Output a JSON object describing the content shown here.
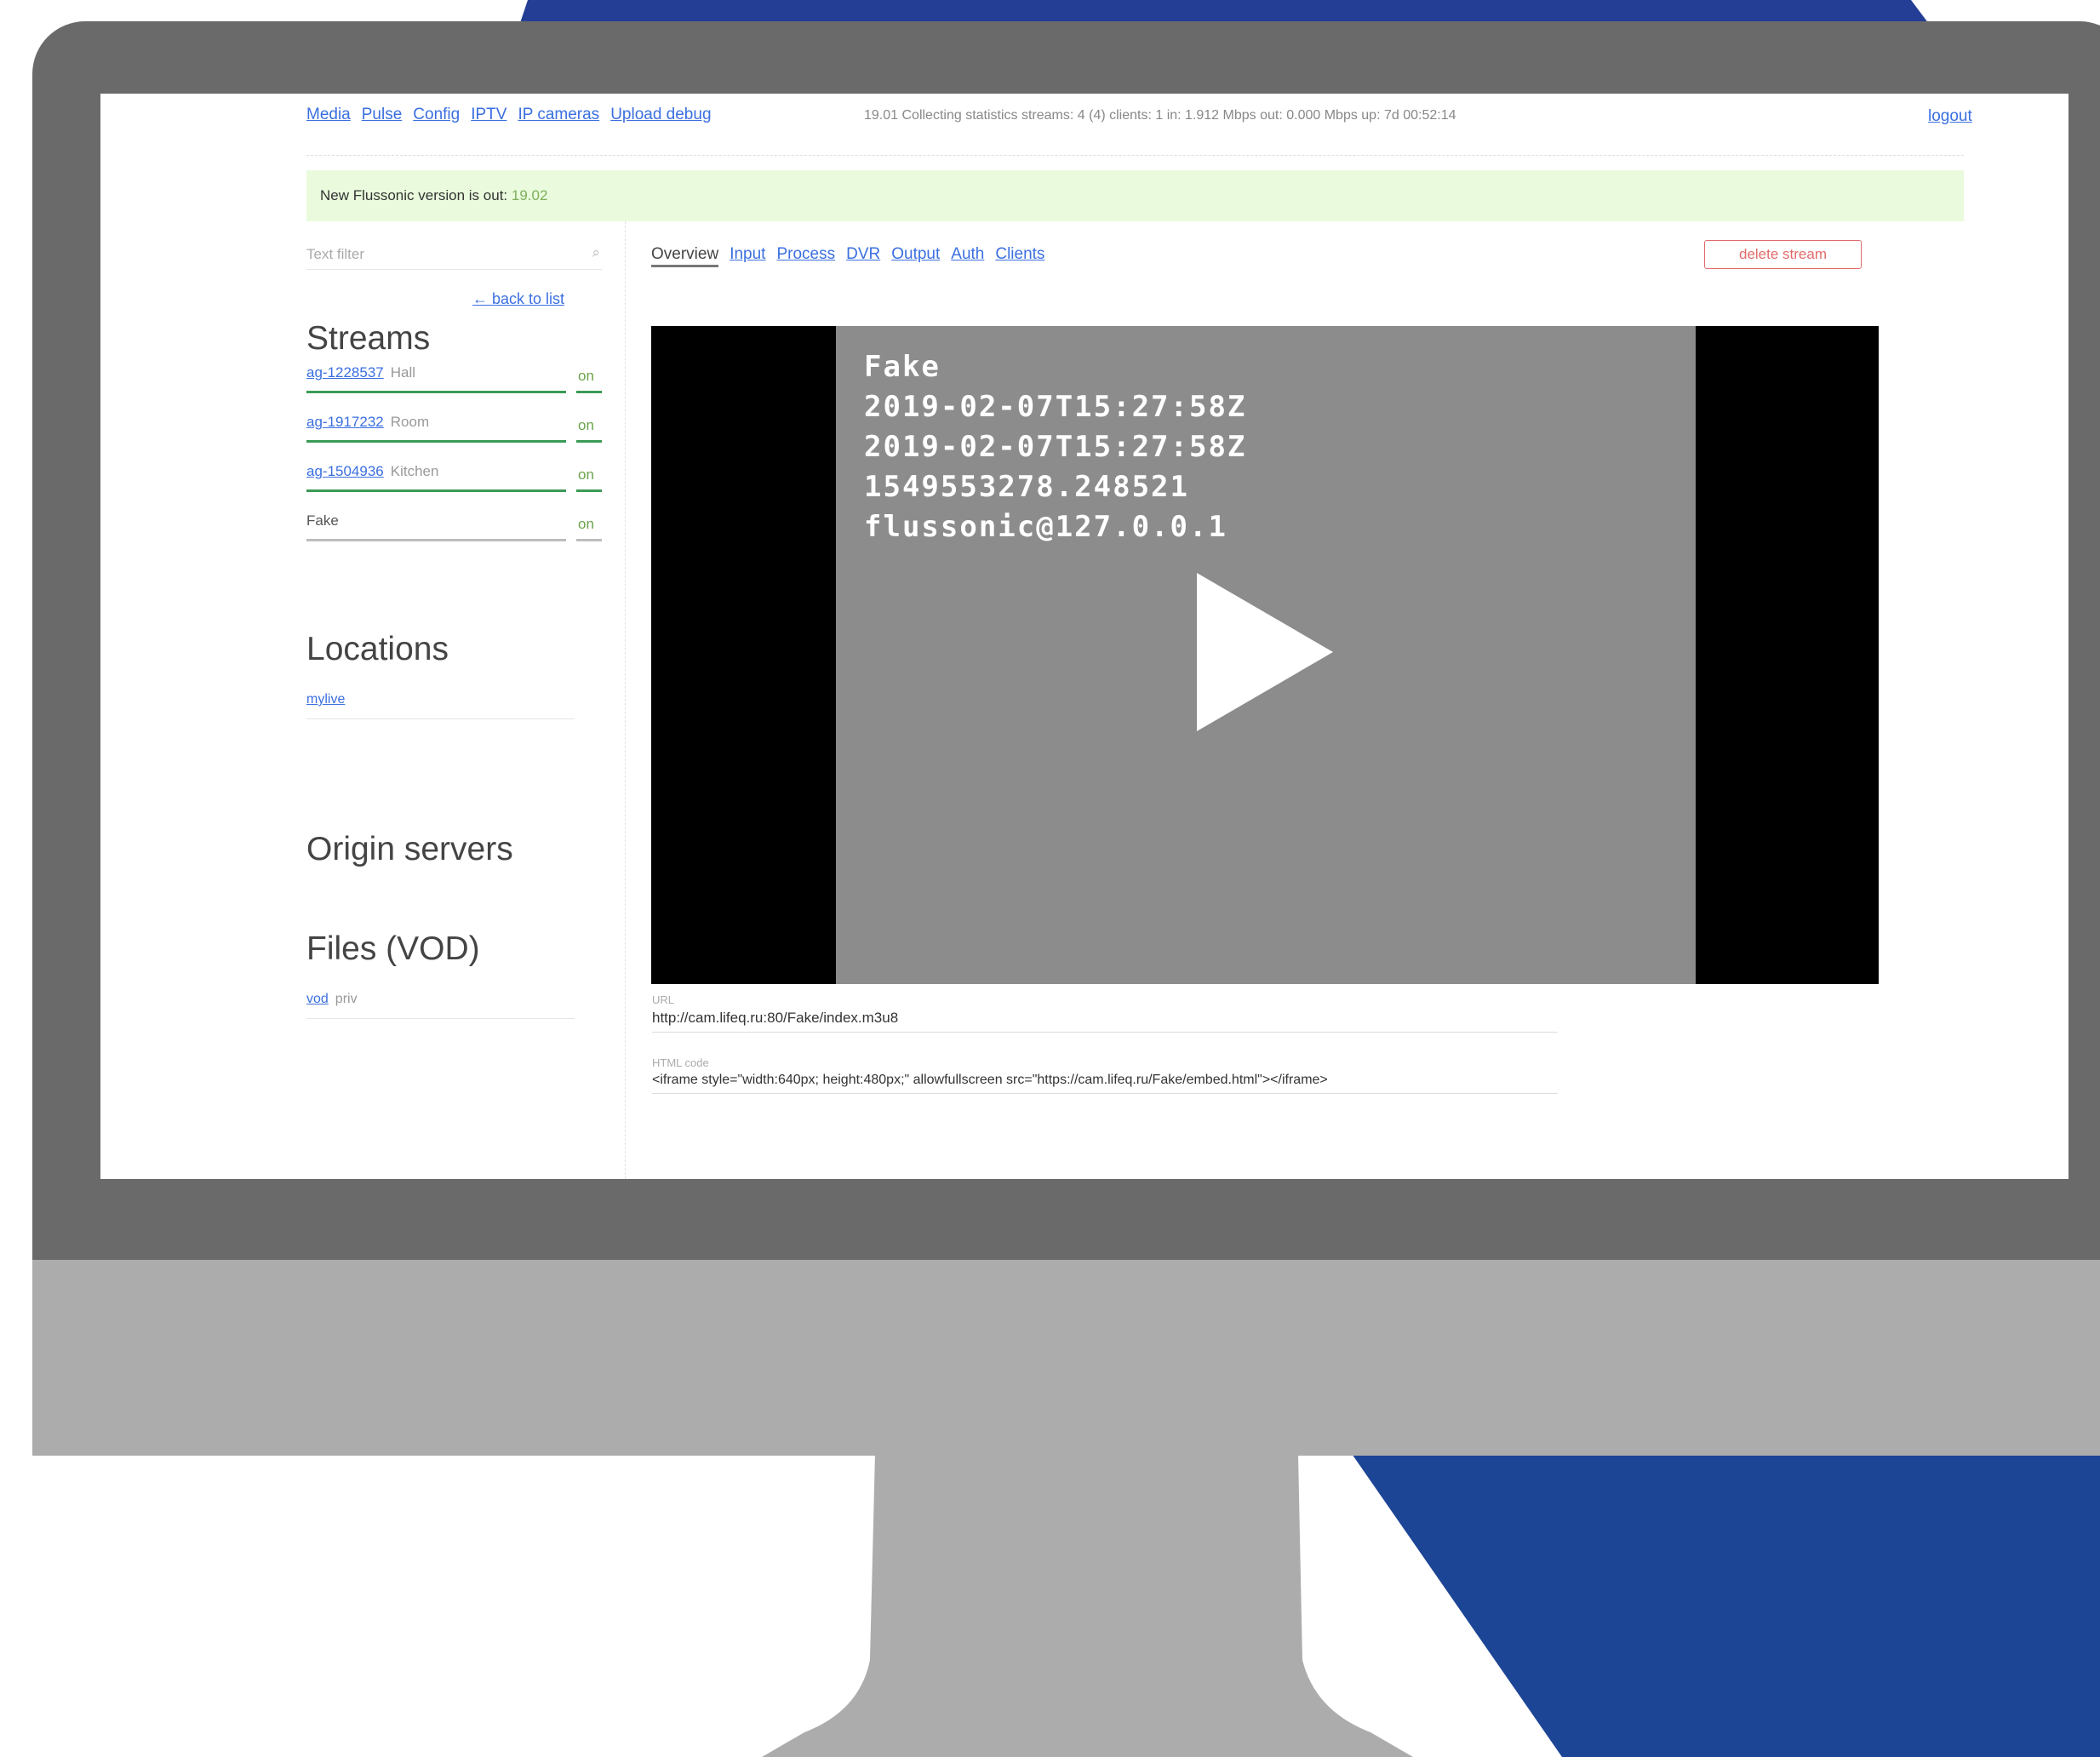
{
  "colors": {
    "accent_blue": "#1d4596",
    "bezel": "#6a6a6a",
    "chin": "#acacac",
    "link": "#3b6fe0",
    "banner_bg": "#e9fbdc",
    "status_on": "#3b9a57",
    "danger": "#e26b6b"
  },
  "nav": {
    "items": [
      "Media",
      "Pulse",
      "Config",
      "IPTV",
      "IP cameras",
      "Upload debug"
    ],
    "status": "19.01  Collecting statistics  streams: 4 (4)  clients: 1  in: 1.912 Mbps  out: 0.000 Mbps  up: 7d 00:52:14",
    "logout": "logout"
  },
  "banner": {
    "text": "New Flussonic version is out: ",
    "version": "19.02"
  },
  "sidebar": {
    "filter_placeholder": "Text filter",
    "search_icon": "search-icon",
    "back_link": "← back to list",
    "streams_heading": "Streams",
    "streams": [
      {
        "id": "ag-1228537",
        "name": "Hall",
        "state": "on"
      },
      {
        "id": "ag-1917232",
        "name": "Room",
        "state": "on"
      },
      {
        "id": "ag-1504936",
        "name": "Kitchen",
        "state": "on"
      },
      {
        "id": "Fake",
        "name": "",
        "state": "on"
      }
    ],
    "locations_heading": "Locations",
    "locations": [
      "mylive"
    ],
    "origin_heading": "Origin servers",
    "files_heading": "Files (VOD)",
    "files": [
      {
        "name": "vod",
        "desc": "priv"
      }
    ]
  },
  "tabs": [
    "Overview",
    "Input",
    "Process",
    "DVR",
    "Output",
    "Auth",
    "Clients"
  ],
  "active_tab": "Overview",
  "delete_button": "delete stream",
  "video": {
    "overlay_lines": [
      "Fake",
      "2019-02-07T15:27:58Z",
      "2019-02-07T15:27:58Z",
      "1549553278.248521",
      "flussonic@127.0.0.1"
    ],
    "play_icon": "play-icon"
  },
  "fields": {
    "url_label": "URL",
    "url_value": "http://cam.lifeq.ru:80/Fake/index.m3u8",
    "html_label": "HTML code",
    "html_value": "<iframe style=\"width:640px; height:480px;\" allowfullscreen src=\"https://cam.lifeq.ru/Fake/embed.html\"></iframe>"
  }
}
